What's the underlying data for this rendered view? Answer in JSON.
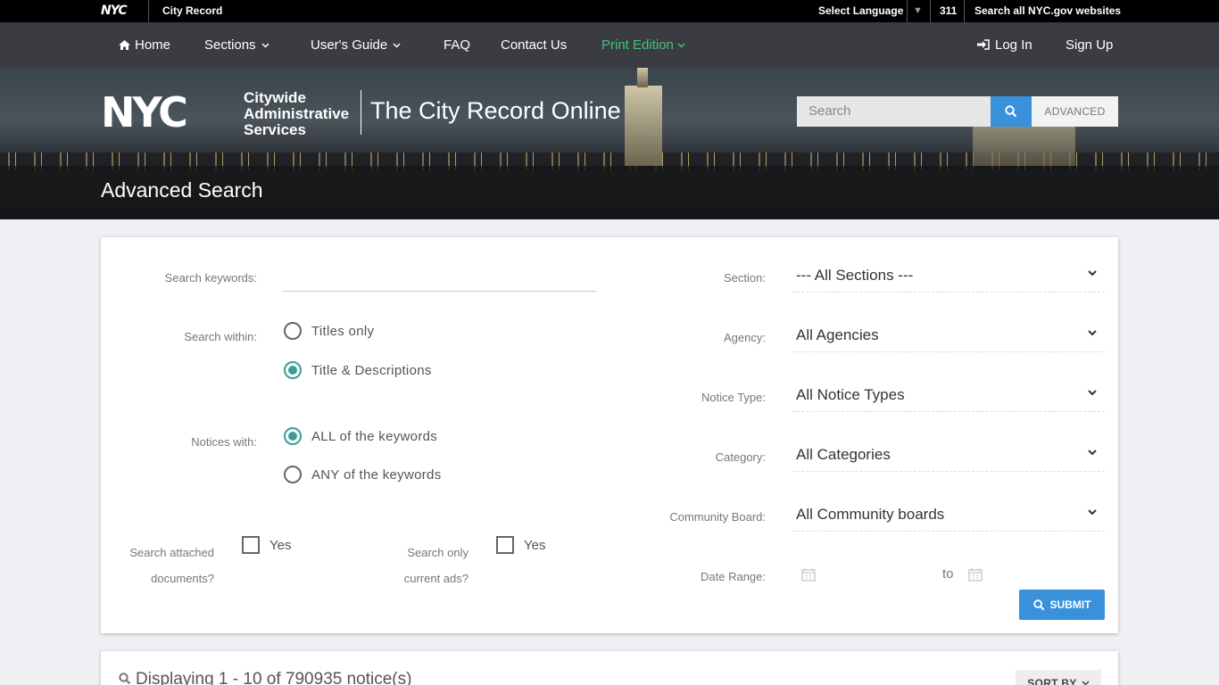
{
  "topbar": {
    "logo": "NYC",
    "site": "City Record",
    "language": "Select Language",
    "language_arrow": "▼",
    "phone": "311",
    "search_all": "Search all NYC.gov websites"
  },
  "nav": {
    "home": "Home",
    "sections": "Sections",
    "users_guide": "User's Guide",
    "faq": "FAQ",
    "contact": "Contact Us",
    "print_edition": "Print Edition",
    "login": "Log In",
    "signup": "Sign Up"
  },
  "hero": {
    "logo_big": "NYC",
    "logo_line1": "Citywide",
    "logo_line2": "Administrative",
    "logo_line3": "Services",
    "site_title": "The City Record Online",
    "search_placeholder": "Search",
    "advanced": "ADVANCED",
    "page_title": "Advanced Search"
  },
  "form": {
    "keywords_label": "Search keywords:",
    "within_label": "Search within:",
    "within_opt1": "Titles only",
    "within_opt2": "Title & Descriptions",
    "notices_label": "Notices with:",
    "notices_opt1": "ALL of the keywords",
    "notices_opt2": "ANY of the keywords",
    "attached_label1": "Search attached",
    "attached_label2": "documents?",
    "attached_yes": "Yes",
    "current_label1": "Search only",
    "current_label2": "current ads?",
    "current_yes": "Yes",
    "section_label": "Section:",
    "section_value": "--- All Sections ---",
    "agency_label": "Agency:",
    "agency_value": "All Agencies",
    "notice_type_label": "Notice Type:",
    "notice_type_value": "All Notice Types",
    "category_label": "Category:",
    "category_value": "All Categories",
    "board_label": "Community Board:",
    "board_value": "All Community boards",
    "date_label": "Date Range:",
    "date_to": "to",
    "submit": "SUBMIT"
  },
  "results": {
    "summary": "Displaying 1 - 10 of 790935 notice(s)",
    "sort_by": "SORT BY"
  },
  "colors": {
    "accent_blue": "#3a91db",
    "radio_teal": "#3e9b99",
    "print_green": "#3fc47e",
    "nav_bg": "#3b3c42"
  }
}
